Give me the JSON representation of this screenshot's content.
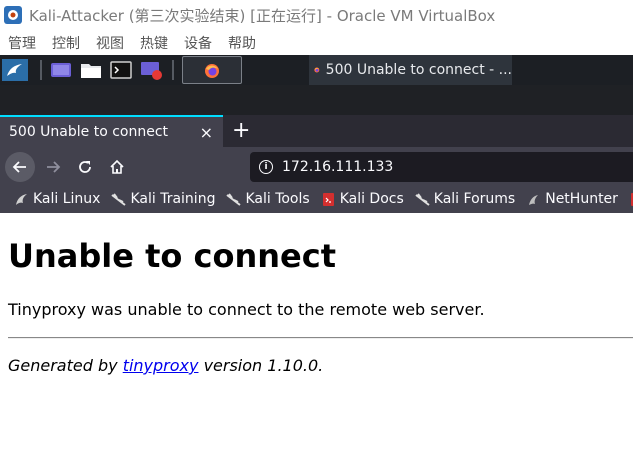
{
  "window": {
    "title": "Kali-Attacker (第三次实验结束) [正在运行] - Oracle VM VirtualBox"
  },
  "vbox_menu": [
    "管理",
    "控制",
    "视图",
    "热键",
    "设备",
    "帮助"
  ],
  "panel": {
    "active_task_title": "500 Unable to connect - ..."
  },
  "browser": {
    "tab_title": "500 Unable to connect",
    "tab_close": "×",
    "new_tab": "+",
    "url": "172.16.111.133",
    "bookmarks": [
      {
        "label": "Kali Linux",
        "icon": "kali-dragon-icon"
      },
      {
        "label": "Kali Training",
        "icon": "kali-dragon-icon"
      },
      {
        "label": "Kali Tools",
        "icon": "kali-dragon-icon"
      },
      {
        "label": "Kali Docs",
        "icon": "kali-docs-icon"
      },
      {
        "label": "Kali Forums",
        "icon": "kali-dragon-icon"
      },
      {
        "label": "NetHunter",
        "icon": "nethunter-icon"
      }
    ]
  },
  "page": {
    "heading": "Unable to connect",
    "message": "Tinyproxy was unable to connect to the remote web server.",
    "footer_prefix": "Generated by",
    "footer_link": "tinyproxy",
    "footer_suffix": "version 1.10.0."
  },
  "colors": {
    "accent": "#00ddff",
    "link": "#0000ee",
    "toolbar": "#42414d",
    "panel": "#1c1f24"
  }
}
